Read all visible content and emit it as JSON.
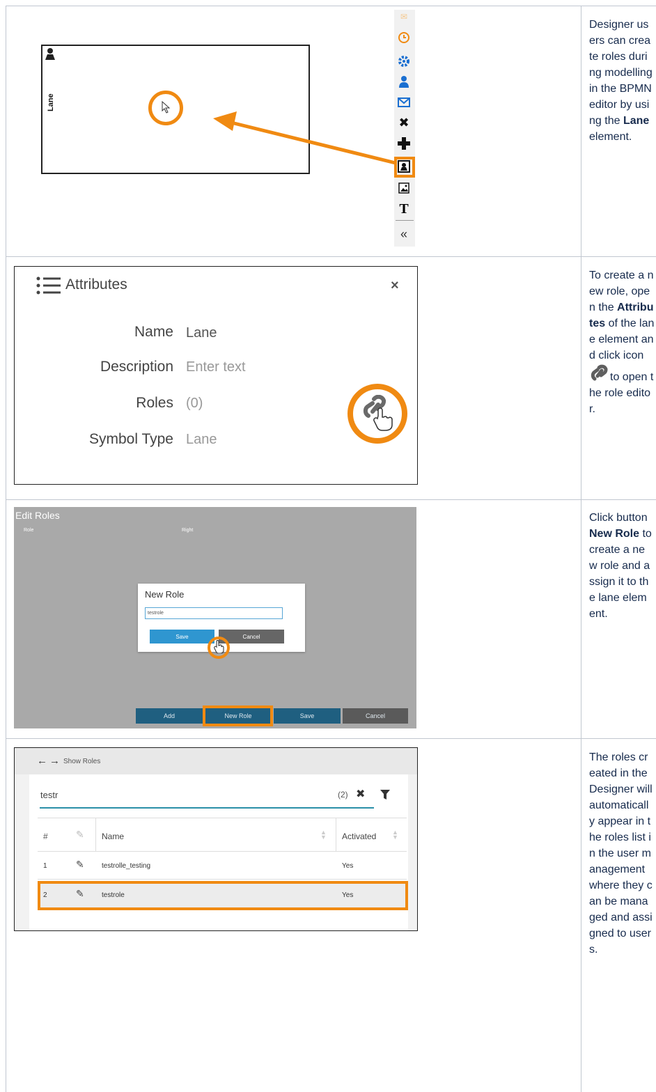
{
  "rows": [
    {
      "description_html": "Designer users can create roles during modelling in the BPMN editor by using the <b>Lane</b> element."
    },
    {
      "description_html": "To create a new role, open the <b>Attributes</b> of the lane element and click icon"
    },
    {
      "description_html": "Click button <b>New Role</b> to create a new role and assign it to the lane element."
    },
    {
      "description_html": "The roles created in the Designer will automatically appear in the roles list in the user management where they can be managed and assigned to users."
    }
  ],
  "row2_tail": "to open the role editor.",
  "lane": {
    "label": "Lane"
  },
  "palette": {
    "icons": [
      "clock-icon",
      "gear-icon",
      "user-icon",
      "mail-icon",
      "delete-icon",
      "plus-icon",
      "lane-icon",
      "image-icon",
      "text-icon",
      "collapse-icon"
    ]
  },
  "attributes": {
    "title": "Attributes",
    "close": "×",
    "fields": [
      {
        "label": "Name",
        "value": "Lane"
      },
      {
        "label": "Description",
        "value": "Enter text"
      },
      {
        "label": "Roles",
        "value": "(0)"
      },
      {
        "label": "Symbol Type",
        "value": "Lane"
      }
    ]
  },
  "edit_roles": {
    "title": "Edit Roles",
    "col_role": "Role",
    "col_right": "Right",
    "dialog_title": "New Role",
    "dialog_input": "testrole",
    "dialog_save": "Save",
    "dialog_cancel": "Cancel",
    "bottom_buttons": [
      "Add",
      "New Role",
      "Save",
      "Cancel"
    ]
  },
  "show_roles": {
    "nav_label": "Show Roles",
    "search_value": "testr",
    "count": "(2)",
    "headers": {
      "num": "#",
      "name": "Name",
      "activated": "Activated"
    },
    "rows": [
      {
        "num": "1",
        "name": "testrolle_testing",
        "activated": "Yes"
      },
      {
        "num": "2",
        "name": "testrole",
        "activated": "Yes"
      }
    ]
  },
  "colors": {
    "accent": "#f08a12",
    "blue": "#1a6fd1",
    "teal": "#1f5f80"
  }
}
